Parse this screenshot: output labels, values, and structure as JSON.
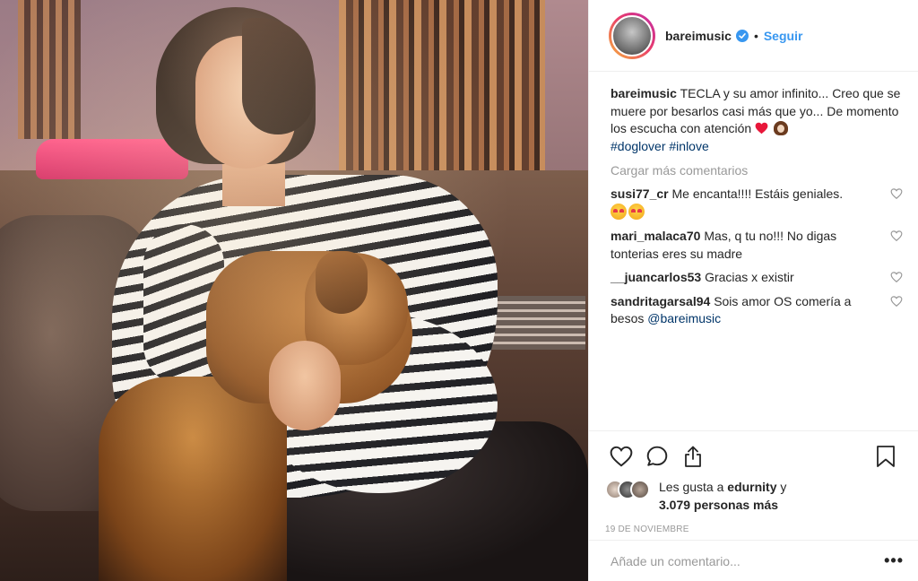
{
  "post": {
    "image_alt_icon": "post-photo"
  },
  "header": {
    "username": "bareimusic",
    "separator": "•",
    "follow_label": "Seguir"
  },
  "caption": {
    "username": "bareimusic",
    "text": "TECLA y su amor infinito... Creo que se muere por besarlos casi más que yo... De momento los escucha con atención",
    "hashtag1": "#doglover",
    "hashtag2": "#inlove"
  },
  "load_more_label": "Cargar más comentarios",
  "comments": [
    {
      "username": "susi77_cr",
      "text": "Me encanta!!!! Estáis geniales."
    },
    {
      "username": "mari_malaca70",
      "text": "Mas, q tu no!!! No digas tonterias eres su madre"
    },
    {
      "username": "__juancarlos53",
      "text": "Gracias x existir"
    },
    {
      "username": "sandritagarsal94",
      "text": "Sois amor OS comería a besos",
      "mention": "@bareimusic"
    }
  ],
  "likes": {
    "prefix": "Les gusta a",
    "user": "edurnity",
    "connector": "y",
    "others": "3.079 personas más"
  },
  "date": "19 DE NOVIEMBRE",
  "add_comment": {
    "placeholder": "Añade un comentario..."
  },
  "more_label": "•••",
  "colors": {
    "accent": "#3897f0",
    "hashtag": "#003569",
    "muted": "#999999",
    "text": "#262626"
  }
}
